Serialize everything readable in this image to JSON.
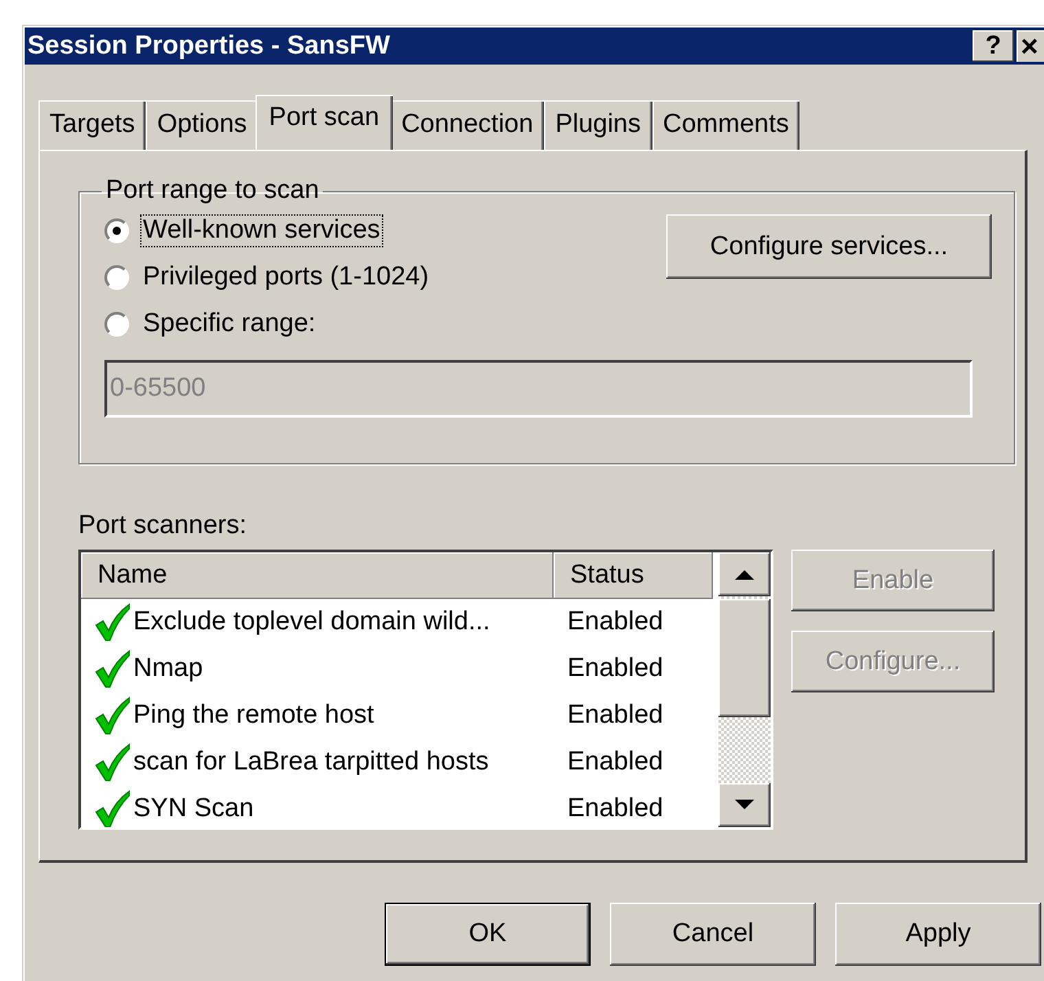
{
  "window": {
    "title": "Session Properties - SansFW",
    "help_button": "?",
    "close_button": "×"
  },
  "tabs": [
    {
      "label": "Targets",
      "selected": false
    },
    {
      "label": "Options",
      "selected": false
    },
    {
      "label": "Port scan",
      "selected": true
    },
    {
      "label": "Connection",
      "selected": false
    },
    {
      "label": "Plugins",
      "selected": false
    },
    {
      "label": "Comments",
      "selected": false
    }
  ],
  "port_range": {
    "title": "Port range to scan",
    "options": [
      {
        "label": "Well-known services",
        "selected": true,
        "focused": true
      },
      {
        "label": "Privileged ports (1-1024)",
        "selected": false,
        "focused": false
      },
      {
        "label": "Specific range:",
        "selected": false,
        "focused": false
      }
    ],
    "range_field": {
      "value": "0-65500",
      "disabled": true
    },
    "configure_button": {
      "label": "Configure services..."
    }
  },
  "port_scanners": {
    "label": "Port scanners:",
    "columns": [
      "Name",
      "Status"
    ],
    "rows": [
      {
        "name": "Exclude toplevel domain wild...",
        "status": "Enabled",
        "enabled": true
      },
      {
        "name": "Nmap",
        "status": "Enabled",
        "enabled": true
      },
      {
        "name": "Ping the remote host",
        "status": "Enabled",
        "enabled": true
      },
      {
        "name": "scan for LaBrea tarpitted hosts",
        "status": "Enabled",
        "enabled": true
      },
      {
        "name": "SYN Scan",
        "status": "Enabled",
        "enabled": true
      }
    ],
    "buttons": [
      {
        "label": "Enable",
        "disabled": true
      },
      {
        "label": "Configure...",
        "disabled": true
      }
    ]
  },
  "buttons": [
    {
      "label": "OK",
      "default": true
    },
    {
      "label": "Cancel",
      "default": false
    },
    {
      "label": "Apply",
      "default": false
    }
  ]
}
